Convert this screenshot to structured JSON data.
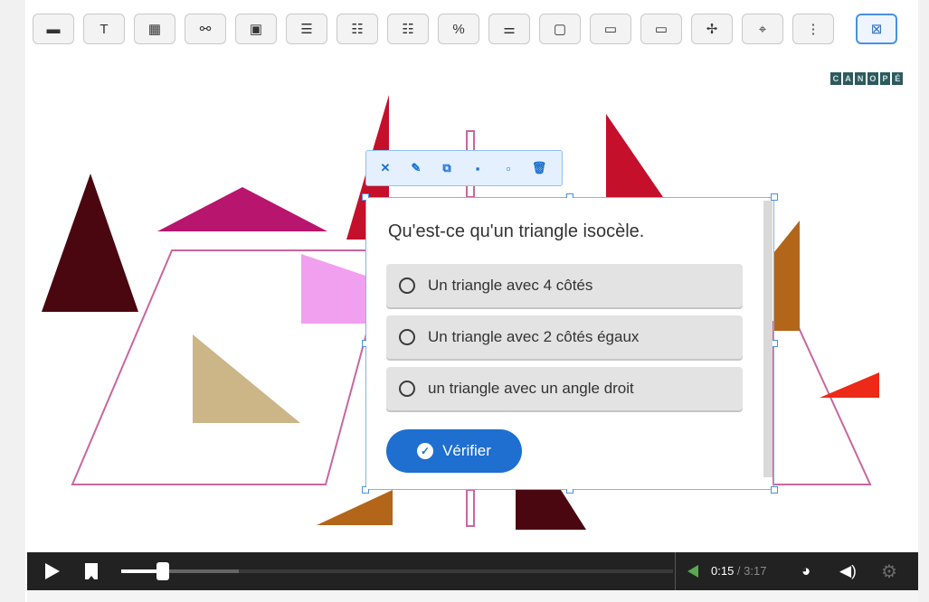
{
  "toolbar": {
    "buttons": [
      {
        "name": "label-icon",
        "glyph": "▬"
      },
      {
        "name": "text-icon",
        "glyph": "T"
      },
      {
        "name": "table-icon",
        "glyph": "▦"
      },
      {
        "name": "link-icon",
        "glyph": "⚯"
      },
      {
        "name": "image-icon",
        "glyph": "▣"
      },
      {
        "name": "text-block-icon",
        "glyph": "☰"
      },
      {
        "name": "ordered-list-icon",
        "glyph": "☷"
      },
      {
        "name": "checklist-icon",
        "glyph": "☷"
      },
      {
        "name": "percent-icon",
        "glyph": "%"
      },
      {
        "name": "sliders-icon",
        "glyph": "⚌"
      },
      {
        "name": "speech-bubble-icon",
        "glyph": "▢"
      },
      {
        "name": "fill-blank-icon",
        "glyph": "▭"
      },
      {
        "name": "drag-text-icon",
        "glyph": "▭"
      },
      {
        "name": "signpost-icon",
        "glyph": "✢"
      },
      {
        "name": "hotspot-icon",
        "glyph": "⌖"
      },
      {
        "name": "more-vertical-icon",
        "glyph": "⋮"
      }
    ],
    "active_button": {
      "name": "clipboard-close-icon",
      "glyph": "⊠"
    }
  },
  "brand": {
    "letters": [
      "C",
      "A",
      "N",
      "O",
      "P",
      "É"
    ]
  },
  "mini_toolbar": {
    "icons": [
      {
        "name": "expand-icon",
        "glyph": "✕"
      },
      {
        "name": "edit-icon",
        "glyph": "✎"
      },
      {
        "name": "copy-icon",
        "glyph": "⧉"
      },
      {
        "name": "bring-forward-icon",
        "glyph": "▪"
      },
      {
        "name": "send-backward-icon",
        "glyph": "▫"
      },
      {
        "name": "delete-icon",
        "glyph": "🗑"
      }
    ]
  },
  "quiz": {
    "question": "Qu'est-ce qu'un triangle isocèle.",
    "options": [
      "Un triangle avec 4 côtés",
      "Un triangle avec 2 côtés égaux",
      "un triangle avec un angle droit"
    ],
    "verify_label": "Vérifier"
  },
  "player": {
    "current_time": "0:15",
    "separator": " / ",
    "total_time": "3:17",
    "progress": 0.076
  },
  "colors": {
    "accent": "#1e6fd0",
    "selection": "#4a90e2",
    "player_bg": "#222222"
  }
}
